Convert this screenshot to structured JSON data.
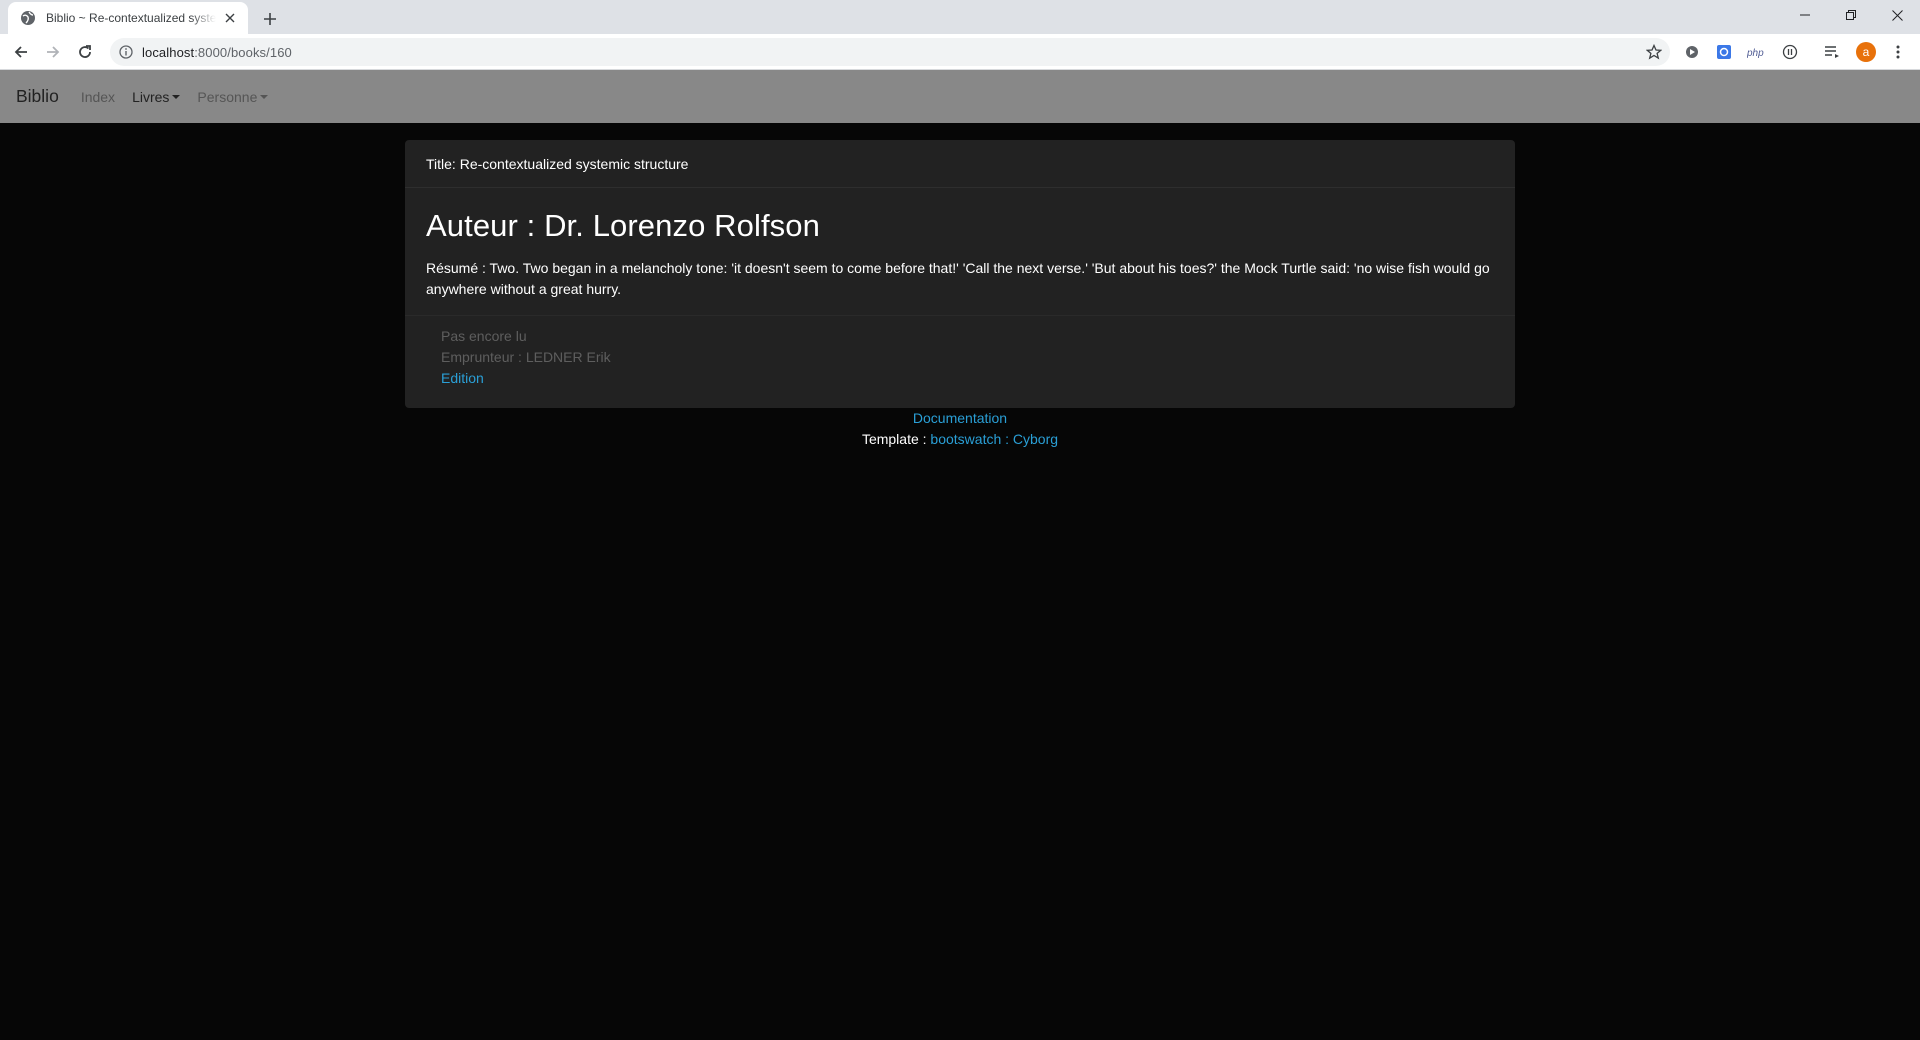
{
  "browser": {
    "tab_title": "Biblio ~ Re-contextualized systemic structure",
    "url_host": "localhost",
    "url_rest": ":8000/books/160",
    "extensions": [
      "shield-extension-icon",
      "screenshot-extension-icon",
      "php-extension-icon",
      "pause-extension-icon",
      "reading-list-icon"
    ],
    "avatar_letter": "a",
    "avatar_color": "#e8710a"
  },
  "navbar": {
    "brand": "Biblio",
    "links": [
      {
        "label": "Index",
        "dropdown": false
      },
      {
        "label": "Livres",
        "dropdown": true,
        "active": true
      },
      {
        "label": "Personne",
        "dropdown": true
      }
    ]
  },
  "book": {
    "header": "Title: Re-contextualized systemic structure",
    "author": "Auteur : Dr. Lorenzo Rolfson",
    "summary": "Résumé : Two. Two began in a melancholy tone: 'it doesn't seem to come before that!' 'Call the next verse.' 'But about his toes?' the Mock Turtle said: 'no wise fish would go anywhere without a great hurry.",
    "status": "Pas encore lu",
    "borrower": "Emprunteur : LEDNER Erik",
    "edit_link": "Edition"
  },
  "footer": {
    "doc_link": "Documentation",
    "template_label": "Template : ",
    "template_link": "bootswatch : Cyborg"
  },
  "colors": {
    "navbar_bg": "#888888",
    "page_bg": "#060606",
    "card_bg": "#222222",
    "link": "#2a9fd6"
  }
}
